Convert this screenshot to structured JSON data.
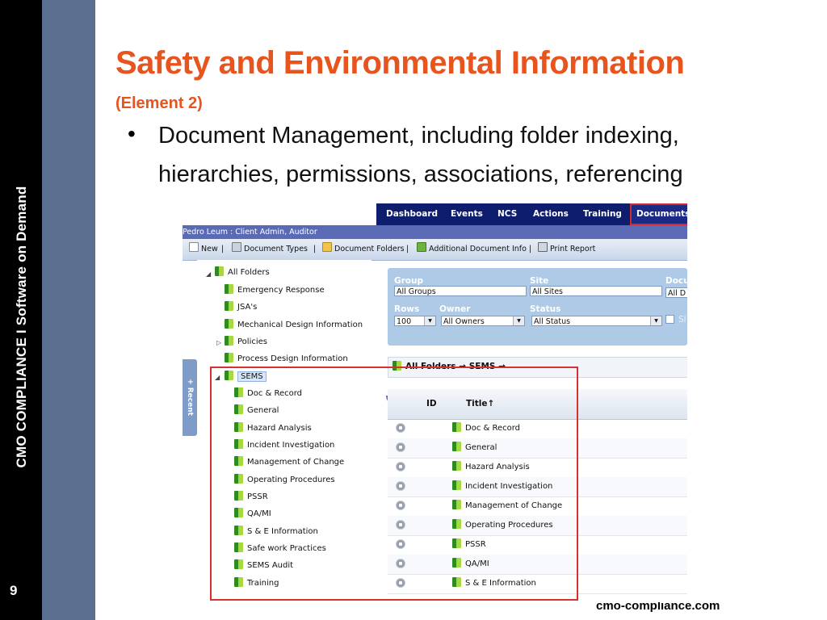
{
  "slide": {
    "brand_vertical": "CMO COMPLIANCE I Software on Demand",
    "page_number": "9",
    "title": "Safety and Environmental Information",
    "subtitle": "(Element 2)",
    "bullet": "Document Management, including folder indexing, hierarchies, permissions, associations, referencing",
    "footer_url": "cmo-compliance.com"
  },
  "app": {
    "nav": {
      "items": [
        "Dashboard",
        "Events",
        "NCS",
        "Actions",
        "Training"
      ],
      "active": "Documents"
    },
    "user_bar": "Pedro Leum : Client Admin, Auditor",
    "toolbar": {
      "new": "New",
      "document_types": "Document Types",
      "document_folders": "Document Folders",
      "additional_info": "Additional Document Info",
      "print_report": "Print Report",
      "sep": "|"
    },
    "recent_tab": "+ Recent",
    "tree": {
      "root": "All Folders",
      "top_folders": [
        "Emergency Response",
        "JSA's",
        "Mechanical Design Information",
        "Policies",
        "Process Design Information"
      ],
      "selected": "SEMS",
      "children": [
        "Doc & Record",
        "General",
        "Hazard Analysis",
        "Incident Investigation",
        "Management of Change",
        "Operating Procedures",
        "PSSR",
        "QA/MI",
        "S & E Information",
        "Safe work Practices",
        "SEMS Audit",
        "Training"
      ]
    },
    "filters": {
      "group_label": "Group",
      "group_value": "All Groups",
      "site_label": "Site",
      "site_value": "All Sites",
      "doc_label": "Docu",
      "doc_value": "All D",
      "rows_label": "Rows",
      "rows_value": "100",
      "owner_label": "Owner",
      "owner_value": "All Owners",
      "status_label": "Status",
      "status_value": "All Status",
      "checkbox_label": "Sl"
    },
    "breadcrumb": "All Folders → SEMS →",
    "grid": {
      "col_id": "ID",
      "col_title": "Title↑",
      "rows": [
        "Doc & Record",
        "General",
        "Hazard Analysis",
        "Incident Investigation",
        "Management of Change",
        "Operating Procedures",
        "PSSR",
        "QA/MI",
        "S & E Information"
      ]
    }
  },
  "colors": {
    "title_orange": "#e8541e",
    "nav_navy": "#0e1d6e",
    "highlight_red": "#d63030",
    "rail_blue": "#5b7090"
  }
}
